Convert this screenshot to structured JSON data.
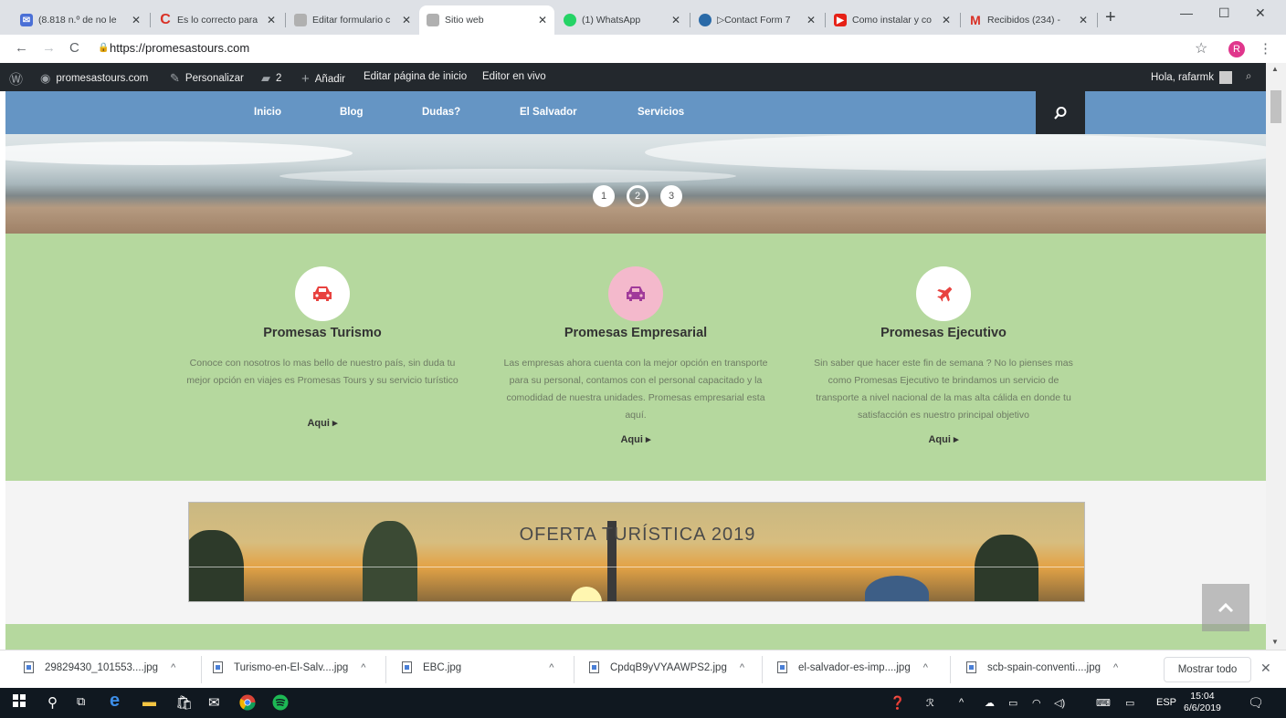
{
  "browser": {
    "tabs": [
      {
        "title": "(8.818 n.º de no le",
        "color": "#4a6fd6"
      },
      {
        "title": "Es lo correcto para",
        "color": "#d93025"
      },
      {
        "title": "Editar formulario c",
        "color": "#8a8a8a"
      },
      {
        "title": "Sitio web",
        "color": "#8a8a8a",
        "active": true
      },
      {
        "title": "(1) WhatsApp",
        "color": "#25d366"
      },
      {
        "title": "▷Contact Form 7",
        "color": "#2a6aa8"
      },
      {
        "title": "Como instalar y co",
        "color": "#e62117"
      },
      {
        "title": "Recibidos (234) - ",
        "color": "#d93025",
        "glyph": "M"
      }
    ],
    "url": "https://promesastours.com",
    "profile_initial": "R"
  },
  "wpbar": {
    "site": "promesastours.com",
    "customize": "Personalizar",
    "comments": "2",
    "add": "Añadir",
    "edit_page": "Editar página de inicio",
    "live_editor": "Editor en vivo",
    "greeting": "Hola, rafarmk"
  },
  "nav": {
    "items": [
      "Inicio",
      "Blog",
      "Dudas?",
      "El Salvador",
      "Servicios"
    ]
  },
  "slider": {
    "dots": [
      "1",
      "2",
      "3"
    ],
    "active_index": 1
  },
  "services": [
    {
      "title": "Promesas Turismo",
      "text": "Conoce con nosotros lo mas bello de nuestro país, sin duda tu mejor opción en viajes es Promesas Tours y su servicio turístico",
      "link": "Aqui ▸",
      "icon": "car-icon",
      "icon_bg": "#ffffff",
      "icon_color": "#e8423f"
    },
    {
      "title": "Promesas Empresarial",
      "text": "Las empresas ahora cuenta con la mejor opción en transporte para su personal, contamos con el personal capacitado y la comodidad de nuestra unidades. Promesas empresarial esta aquí.",
      "link": "Aqui ▸",
      "icon": "car-icon",
      "icon_bg": "#f4b9cc",
      "icon_color": "#a03a9a"
    },
    {
      "title": "Promesas Ejecutivo",
      "text": "Sin saber que hacer este fin de semana ? No lo pienses mas como Promesas Ejecutivo te brindamos un servicio de transporte a nivel nacional de la mas alta cálida en donde tu satisfacción es nuestro principal objetivo",
      "link": "Aqui ▸",
      "icon": "plane-icon",
      "icon_bg": "#ffffff",
      "icon_color": "#e8423f"
    }
  ],
  "offer": {
    "title": "OFERTA TURÍSTICA 2019"
  },
  "downloads": {
    "items": [
      "29829430_101553....jpg",
      "Turismo-en-El-Salv....jpg",
      "EBC.jpg",
      "CpdqB9yVYAAWPS2.jpg",
      "el-salvador-es-imp....jpg",
      "scb-spain-conventi....jpg"
    ],
    "show_all": "Mostrar todo"
  },
  "taskbar": {
    "lang": "ESP",
    "time": "15:04",
    "date": "6/6/2019"
  }
}
